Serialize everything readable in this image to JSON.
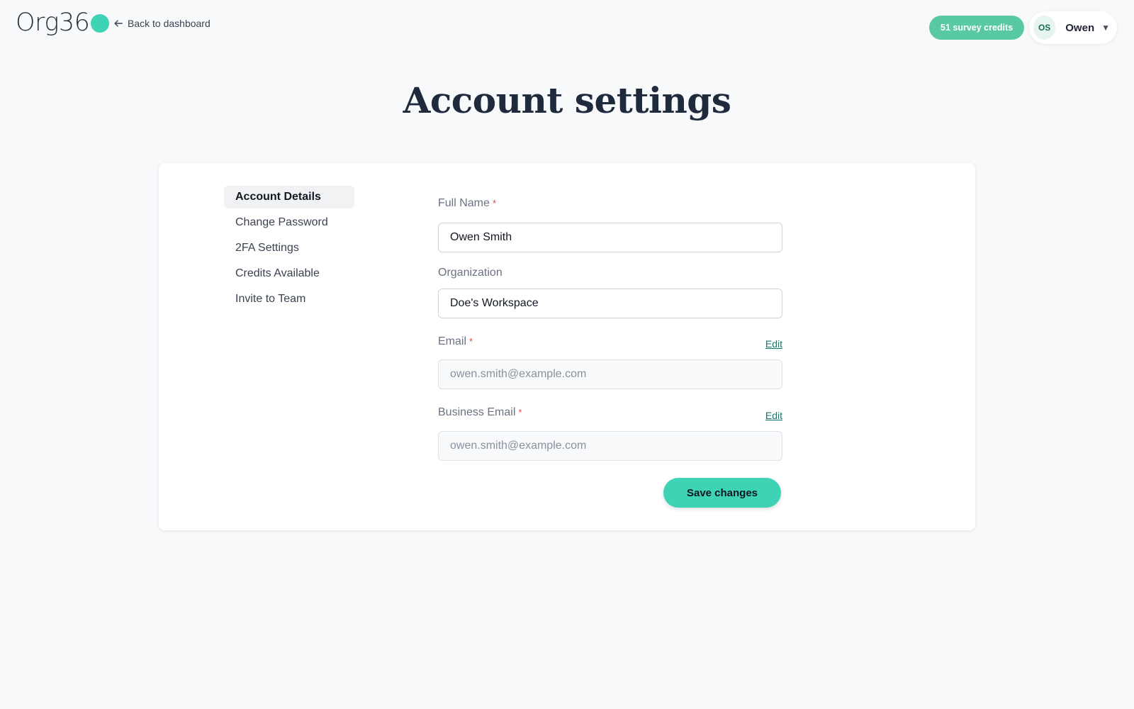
{
  "header": {
    "logo_text": "Org36",
    "back_link": "Back to dashboard",
    "credits_badge": "51 survey credits",
    "user": {
      "initials": "OS",
      "name": "Owen"
    }
  },
  "page": {
    "title": "Account settings"
  },
  "sidebar": {
    "items": [
      {
        "label": "Account Details",
        "active": true
      },
      {
        "label": "Change Password",
        "active": false
      },
      {
        "label": "2FA Settings",
        "active": false
      },
      {
        "label": "Credits Available",
        "active": false
      },
      {
        "label": "Invite to Team",
        "active": false
      }
    ]
  },
  "form": {
    "full_name": {
      "label": "Full Name",
      "required": "*",
      "value": "Owen Smith"
    },
    "organization": {
      "label": "Organization",
      "value": "Doe's Workspace"
    },
    "email": {
      "label": "Email",
      "required": "*",
      "value": "owen.smith@example.com",
      "edit": "Edit"
    },
    "business_email": {
      "label": "Business Email",
      "required": "*",
      "value": "owen.smith@example.com",
      "edit": "Edit"
    },
    "save_label": "Save changes"
  },
  "colors": {
    "accent": "#3dd3b4",
    "badge": "#59c9a5",
    "link": "#117a6a",
    "required": "#e5484d"
  },
  "icons": {
    "back": "arrow-left-icon",
    "dropdown": "caret-down-icon"
  }
}
